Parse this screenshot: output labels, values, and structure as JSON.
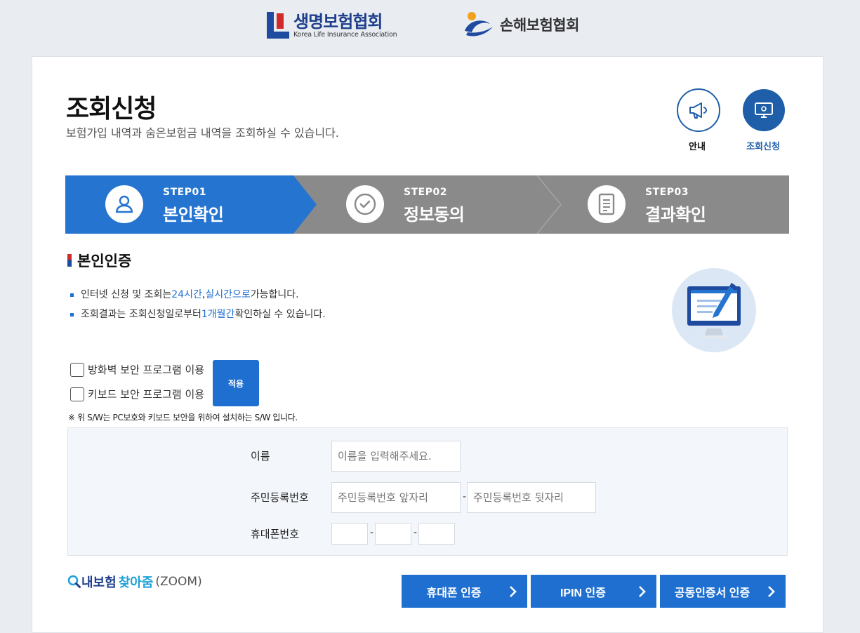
{
  "header": {
    "logo1_ko": "생명보험협회",
    "logo1_en": "Korea Life Insurance Association",
    "logo2_ko": "손해보험협회"
  },
  "page": {
    "title": "조회신청",
    "subtitle": "보험가입 내역과 숨은보험금 내역을 조회하실 수 있습니다."
  },
  "quick_buttons": [
    {
      "label": "안내",
      "icon": "megaphone-icon"
    },
    {
      "label": "조회신청",
      "icon": "monitor-icon"
    }
  ],
  "steps": [
    {
      "num": "STEP01",
      "name": "본인확인",
      "icon": "user-icon",
      "active": true
    },
    {
      "num": "STEP02",
      "name": "정보동의",
      "icon": "check-circle-icon",
      "active": false
    },
    {
      "num": "STEP03",
      "name": "결과확인",
      "icon": "document-icon",
      "active": false
    }
  ],
  "section": {
    "title": "본인인증",
    "notes": [
      {
        "pre": "인터넷 신청 및 조회는 ",
        "hl1": "24시간",
        "mid": ", ",
        "hl2": "실시간으로",
        "post": " 가능합니다."
      },
      {
        "pre": "조회결과는 조회신청일로부터 ",
        "hl1": "1개월간",
        "post": " 확인하실 수 있습니다."
      }
    ]
  },
  "security": {
    "firewall_label": "방화벽 보안 프로그램 이용",
    "keyboard_label": "키보드 보안 프로그램 이용",
    "apply_label": "적용",
    "note": "※ 위 S/W는 PC보호와 키보드 보안을 위하여 설치하는 S/W 입니다."
  },
  "form": {
    "name_label": "이름",
    "name_placeholder": "이름을 입력해주세요.",
    "rrn_label": "주민등록번호",
    "rrn_front_placeholder": "주민등록번호 앞자리",
    "rrn_back_placeholder": "주민등록번호 뒷자리",
    "phone_label": "휴대폰번호",
    "dash": "-"
  },
  "zoom": {
    "part1": "내보험",
    "part2": "찾아줌",
    "part3": "(ZOOM)"
  },
  "auth_buttons": [
    {
      "label": "휴대폰 인증"
    },
    {
      "label": "IPIN 인증"
    },
    {
      "label": "공동인증서 인증"
    }
  ],
  "colors": {
    "active_step": "#2474d0",
    "inactive_step": "#8a8a8a",
    "primary": "#1f6fd0",
    "brand_navy": "#1e3f8c"
  }
}
